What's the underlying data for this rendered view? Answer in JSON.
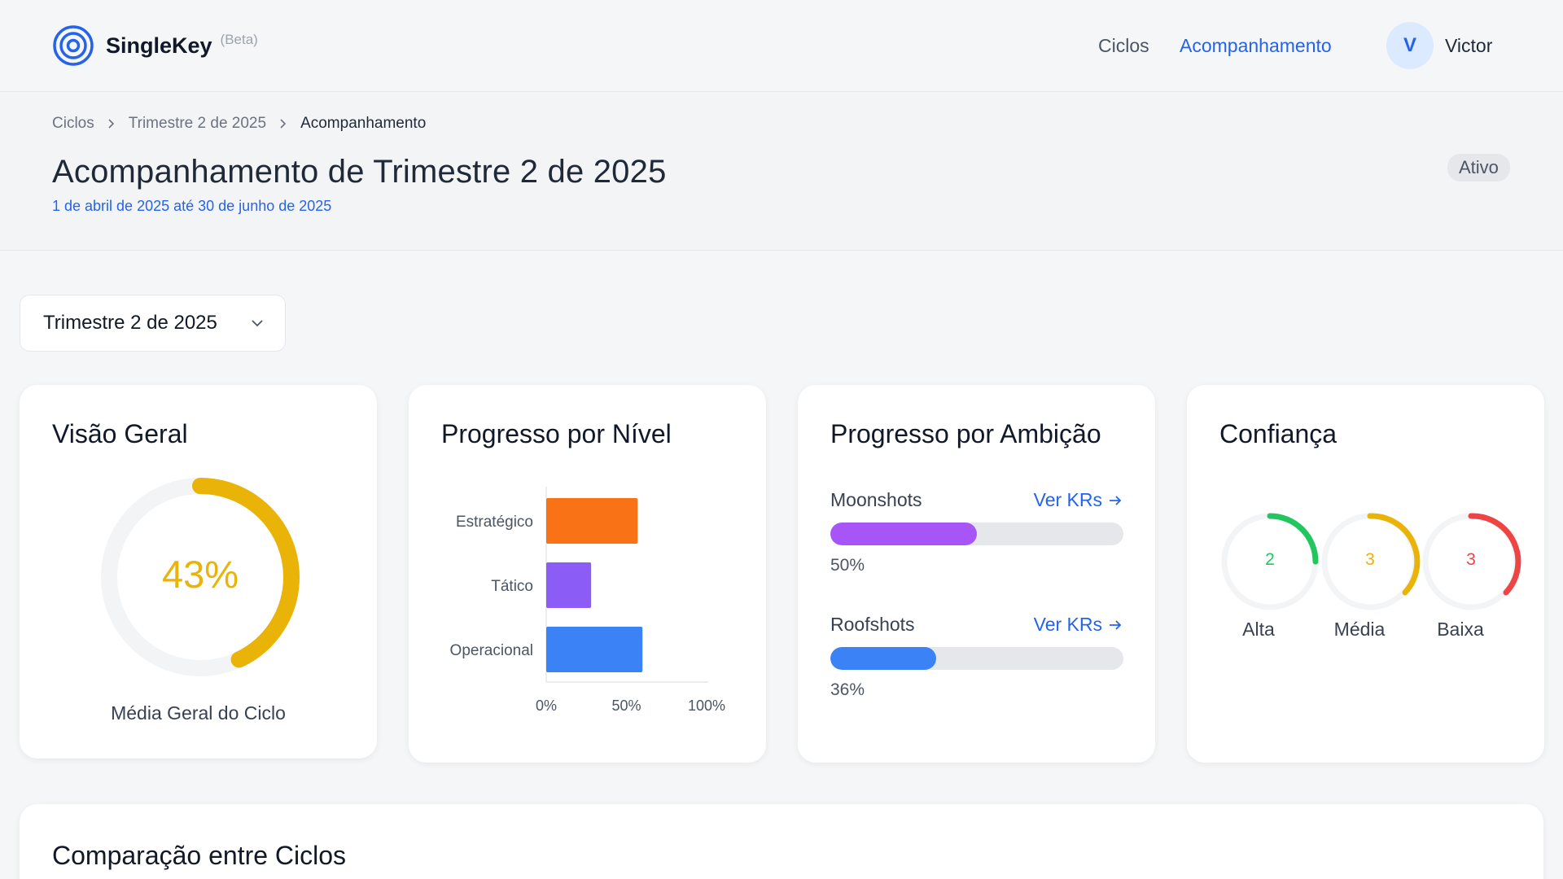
{
  "header": {
    "brand": "SingleKey",
    "badge": "(Beta)",
    "nav": [
      {
        "label": "Ciclos"
      },
      {
        "label": "Acompanhamento"
      }
    ],
    "user": {
      "initial": "V",
      "name": "Victor"
    },
    "accent": "#2563eb"
  },
  "breadcrumb": [
    "Ciclos",
    "Trimestre 2 de 2025",
    "Acompanhamento"
  ],
  "page": {
    "title": "Acompanhamento de Trimestre 2 de 2025",
    "dates": "1 de abril de 2025 até 30 de junho de 2025",
    "status": "Ativo"
  },
  "cycle_select": {
    "value": "Trimestre 2 de 2025"
  },
  "overview": {
    "title": "Visão Geral",
    "value": "43%",
    "progress": 0.43,
    "caption": "Média Geral do Ciclo",
    "color": "#eab308"
  },
  "level": {
    "title": "Progresso por Nível",
    "chart_data": {
      "type": "bar",
      "orientation": "horizontal",
      "categories": [
        "Estratégico",
        "Tático",
        "Operacional"
      ],
      "values": [
        57,
        28,
        60
      ],
      "colors": [
        "#f97316",
        "#8b5cf6",
        "#3b82f6"
      ],
      "xlim": [
        0,
        100
      ],
      "xticks": [
        "0%",
        "50%",
        "100%"
      ]
    }
  },
  "ambition": {
    "title": "Progresso por Ambição",
    "items": [
      {
        "name": "Moonshots",
        "link": "Ver KRs",
        "value": 50,
        "pct": "50%",
        "color": "#a855f7"
      },
      {
        "name": "Roofshots",
        "link": "Ver KRs",
        "value": 36,
        "pct": "36%",
        "color": "#3b82f6"
      }
    ]
  },
  "confidence": {
    "title": "Confiança",
    "items": [
      {
        "label": "Alta",
        "count": "2",
        "color": "#22c55e"
      },
      {
        "label": "Média",
        "count": "3",
        "color": "#eab308"
      },
      {
        "label": "Baixa",
        "count": "3",
        "color": "#ef4444"
      }
    ]
  },
  "comparison": {
    "title": "Comparação entre Ciclos"
  }
}
